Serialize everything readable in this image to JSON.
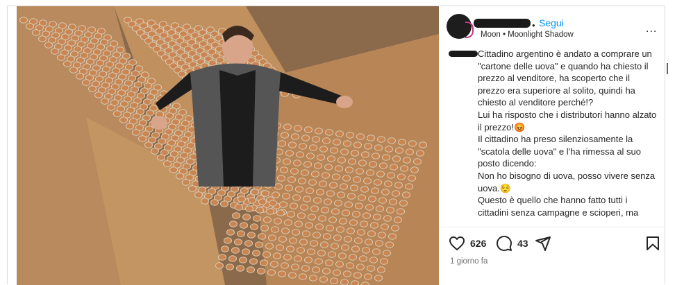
{
  "post": {
    "follow_label": "Segui",
    "separator": "•",
    "audio": "Moon • Moonlight Shadow",
    "more_label": "...",
    "caption": "Cittadino argentino è andato a comprare un \"cartone delle uova\" e quando ha chiesto il prezzo al venditore, ha scoperto che il prezzo era superiore al solito, quindi ha chiesto al venditore perché!?\nLui ha risposto che i distributori hanno alzato il prezzo!😡\nIl cittadino ha preso silenziosamente la \"scatola delle uova\" e l'ha rimessa al suo posto dicendo:\nNon ho bisogno di uova, posso vivere senza uova.😌\nQuesto è quello che hanno fatto tutti i cittadini senza campagne e scioperi, ma",
    "likes": "626",
    "comments": "43",
    "timestamp": "1 giorno fa"
  },
  "icons": {
    "like": "heart-icon",
    "comment": "comment-icon",
    "share": "share-icon",
    "save": "bookmark-icon",
    "more": "more-icon"
  },
  "colors": {
    "link_blue": "#0095f6",
    "text": "#262626",
    "muted": "#737373",
    "egg": "#c98552",
    "tray": "#d8ccb6"
  }
}
